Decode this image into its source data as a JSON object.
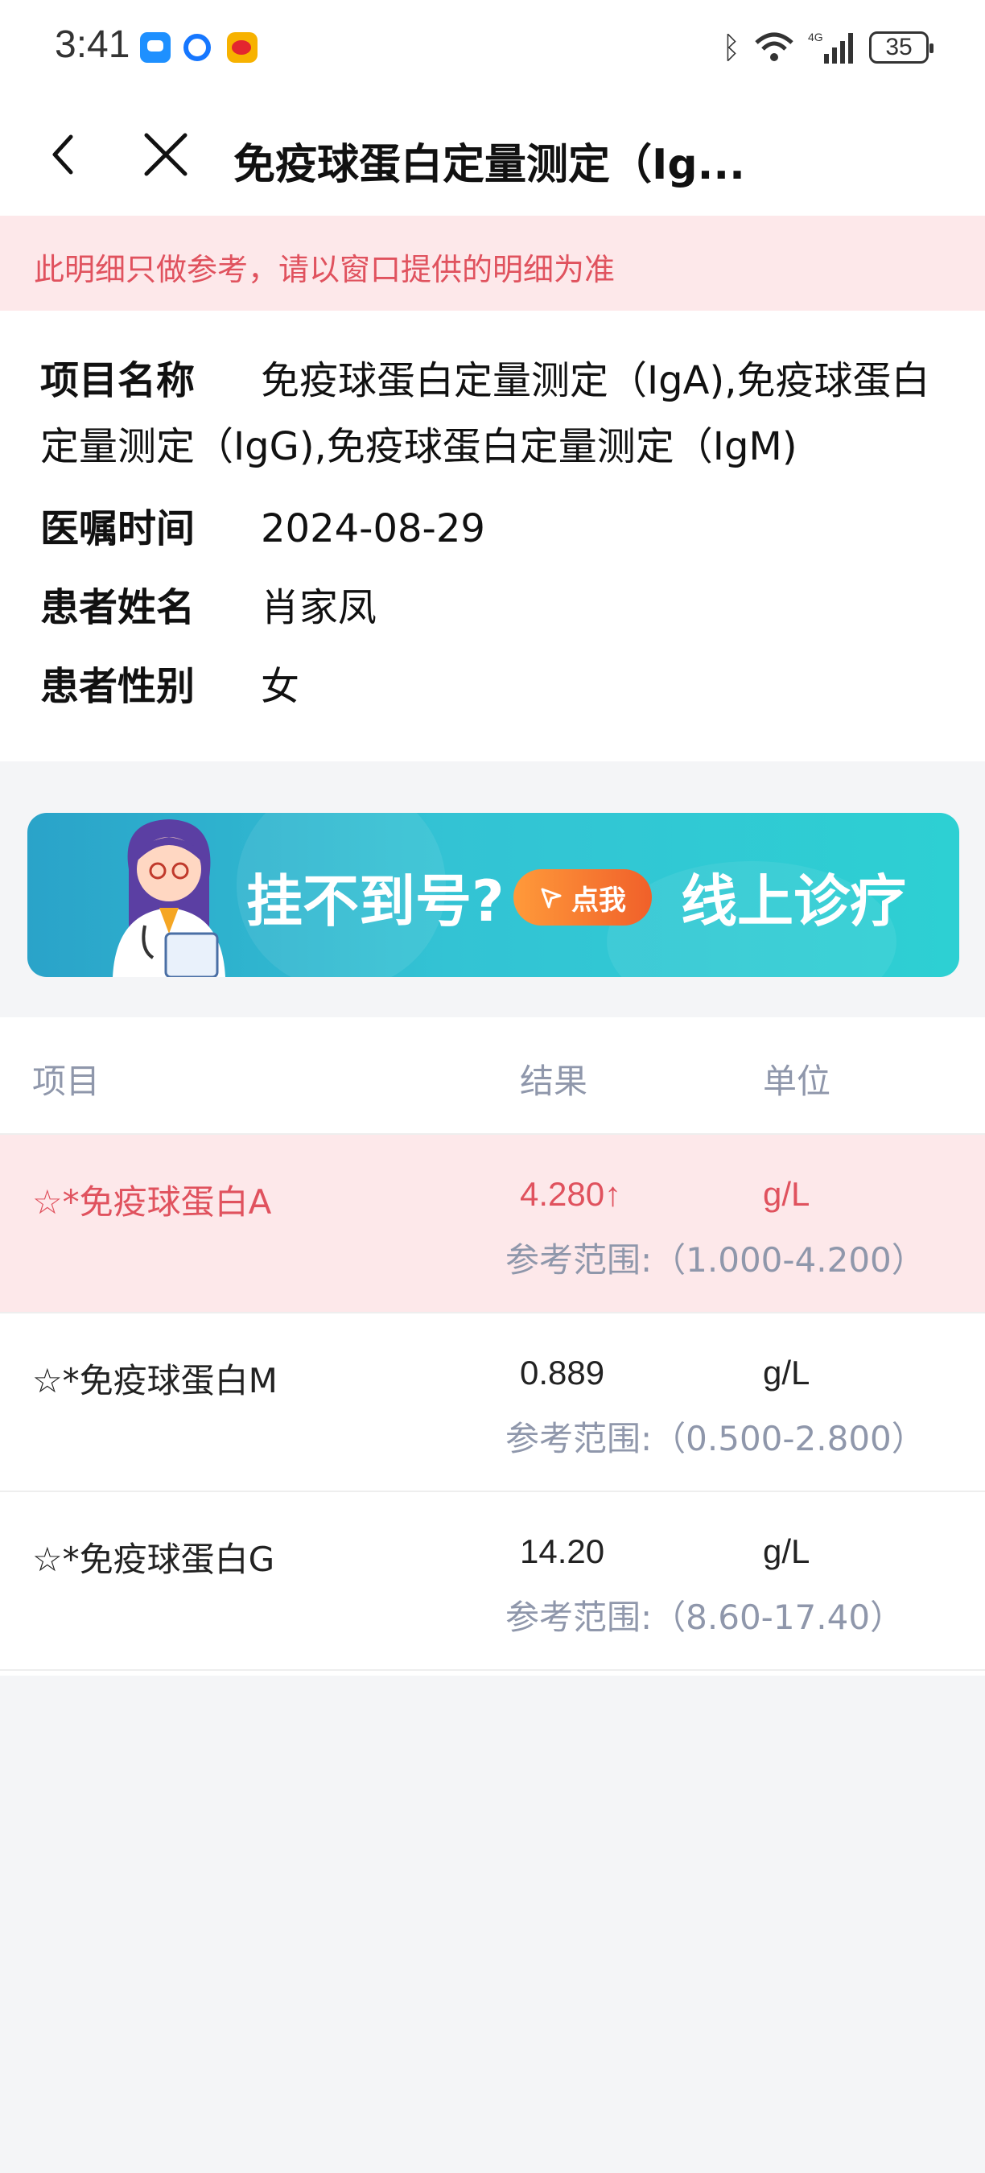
{
  "status_bar": {
    "time": "3:41",
    "battery": "35"
  },
  "nav": {
    "title": "免疫球蛋白定量测定（Ig..."
  },
  "notice": {
    "text": "此明细只做参考，请以窗口提供的明细为准"
  },
  "info": {
    "name_label": "项目名称",
    "name_value": "免疫球蛋白定量测定（IgA),免疫球蛋白定量测定（IgG),免疫球蛋白定量测定（IgM)",
    "time_label": "医嘱时间",
    "time_value": "2024-08-29",
    "patient_label": "患者姓名",
    "patient_value": "肖家凤",
    "gender_label": "患者性别",
    "gender_value": "女"
  },
  "ad": {
    "headline": "挂不到号?",
    "button": "点我",
    "cta": "线上诊疗"
  },
  "results": {
    "header": {
      "item": "项目",
      "result": "结果",
      "unit": "单位"
    },
    "rows": [
      {
        "name": "☆*免疫球蛋白A",
        "value": "4.280↑",
        "unit": "g/L",
        "range": "参考范围:（1.000-4.200）",
        "abnormal": true
      },
      {
        "name": "☆*免疫球蛋白M",
        "value": "0.889",
        "unit": "g/L",
        "range": "参考范围:（0.500-2.800）",
        "abnormal": false
      },
      {
        "name": "☆*免疫球蛋白G",
        "value": "14.20",
        "unit": "g/L",
        "range": "参考范围:（8.60-17.40）",
        "abnormal": false
      }
    ]
  },
  "colors": {
    "accent_red": "#e0525e",
    "notice_bg": "#fde8ea",
    "muted_text": "#8f97ab",
    "banner_teal": "#33c3d4",
    "banner_orange": "#f0602a"
  }
}
